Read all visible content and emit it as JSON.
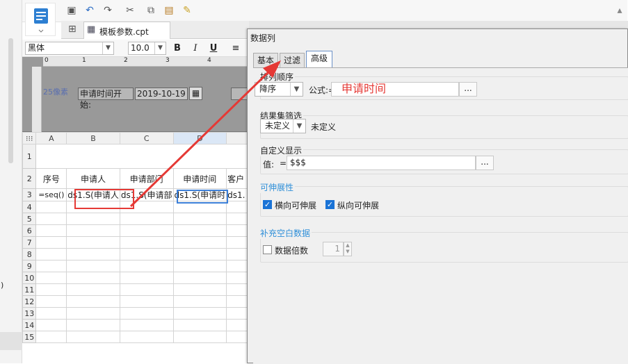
{
  "left_strip": {
    "paren": ")"
  },
  "tab": {
    "label": "模板参数.cpt"
  },
  "font_toolbar": {
    "font": "黑体",
    "size": "10.0",
    "bold": "B",
    "italic": "I",
    "underline": "U"
  },
  "param_panel": {
    "ruler_marks": [
      "0",
      "1",
      "2",
      "3",
      "4"
    ],
    "pixel_label": "25像素",
    "start_label": "申请时间开始:",
    "start_value": "2019-10-19"
  },
  "grid": {
    "columns": [
      "A",
      "B",
      "C",
      "D"
    ],
    "rows": [
      "1",
      "2",
      "3",
      "4",
      "5",
      "6",
      "7",
      "8",
      "9",
      "10",
      "11",
      "12",
      "13",
      "14",
      "15"
    ],
    "header_row": [
      "序号",
      "申请人",
      "申请部门",
      "申请时间",
      "客户"
    ],
    "formula_row": [
      "=seq()",
      "ds1.S(申请人",
      "ds1.S(申请部",
      "ds1.S(申请时",
      "ds1."
    ]
  },
  "dialog": {
    "title": "数据列",
    "tabs": [
      "基本",
      "过滤",
      "高级"
    ],
    "sort": {
      "label": "排列顺序",
      "order": "降序",
      "formula_label": "公式:=",
      "formula_value": "申请时间",
      "dots": "..."
    },
    "filter": {
      "label": "结果集筛选",
      "value": "未定义",
      "text": "未定义"
    },
    "custom": {
      "label": "自定义显示",
      "value_label": "值:",
      "eq": "=",
      "value": "$$$",
      "dots": "..."
    },
    "expand": {
      "label": "可伸展性",
      "horizontal": "横向可伸展",
      "vertical": "纵向可伸展"
    },
    "fill": {
      "label": "补充空白数据",
      "multiple_label": "数据倍数",
      "multiple_value": "1"
    }
  },
  "colors": {
    "accent": "#2f8fd8",
    "annotation": "#e53935",
    "selection": "#3c7fd8"
  }
}
